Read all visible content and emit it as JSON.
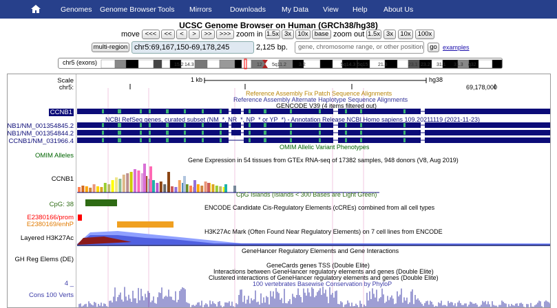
{
  "nav": {
    "items": [
      "Genomes",
      "Genome Browser",
      "Tools",
      "Mirrors",
      "Downloads",
      "My Data",
      "View",
      "Help",
      "About Us"
    ]
  },
  "title": "UCSC Genome Browser on Human (GRCh38/hg38)",
  "move": {
    "label": "move",
    "buttons": [
      "<<<",
      "<<",
      "<",
      ">",
      ">>",
      ">>>"
    ],
    "zoom_in_label": "zoom in",
    "zoom_in_buttons": [
      "1.5x",
      "3x",
      "10x",
      "base"
    ],
    "zoom_out_label": "zoom out",
    "zoom_out_buttons": [
      "1.5x",
      "3x",
      "10x",
      "100x"
    ]
  },
  "position": {
    "multi_region": "multi-region",
    "value": "chr5:69,167,150-69,178,245",
    "size": "2,125 bp.",
    "search_placeholder": "gene, chromosome range, or other position, see examples",
    "go": "go",
    "examples": "examples"
  },
  "ideogram": {
    "label": "chr5 (exons)",
    "bands": [
      "15.2",
      "14.3",
      "12",
      "5q11.2",
      "3.2",
      "5q14.3",
      "5q15",
      "21.3",
      "23.1",
      "23.2",
      "31.1",
      "31.3",
      "q32",
      "5q34"
    ]
  },
  "scale": {
    "label": "Scale",
    "chrom": "chr5:",
    "bar": "1 kb",
    "assembly": "hg38",
    "coord": "69,178,000"
  },
  "tracks": {
    "fix_patch": "Reference Assembly Fix Patch Sequence Alignments",
    "alt_haplo": "Reference Assembly Alternate Haplotype Sequence Alignments",
    "gencode": "GENCODE V39 (4 items filtered out)",
    "gencode_label": "CCNB1",
    "refseq": "NCBI RefSeq genes, curated subset (NM_*, NR_*, NP_* or YP_*) - Annotation Release NCBI Homo sapiens 109.20211119 (2021-11-23)",
    "refseq_labels": [
      "CNB1/NM_001354845.2",
      "CNB1/NM_001354844.2",
      "CCNB1/NM_031966.4"
    ],
    "omim": "OMIM Allelic Variant Phenotypes",
    "omim_label": "OMIM Alleles",
    "gtex": "Gene Expression in 54 tissues from GTEx RNA-seq of 17382 samples, 948 donors (V8, Aug 2019)",
    "gtex_label": "CCNB1",
    "cpg": "CpG Islands (Islands < 300 Bases are Light Green)",
    "cpg_label": "CpG: 38",
    "encode": "ENCODE Candidate Cis-Regulatory Elements (cCREs) combined from all cell types",
    "encode_labels": [
      "E2380166/prom",
      "E2380169/enhP"
    ],
    "h3k27ac": "H3K27Ac Mark (Often Found Near Regulatory Elements) on 7 cell lines from ENCODE",
    "h3k27ac_label": "Layered H3K27Ac",
    "genehancer": "GeneHancer Regulatory Elements and Gene Interactions",
    "genehancer_label": "GH Reg Elems (DE)",
    "gh_tss": "GeneCards genes TSS (Double Elite)",
    "gh_interactions": "Interactions between GeneHancer regulatory elements and genes (Double Elite)",
    "gh_clustered": "Clustered interactions of GeneHancer regulatory elements and genes (Double Elite)",
    "phylop": "100 vertebrates Basewise Conservation by PhyloP",
    "cons_label": "Cons 100 Verts",
    "cons_scale": "4 _"
  },
  "colors": {
    "nav": "#27408b",
    "gene": "#0c0c78",
    "omim": "#006400",
    "cpg": "#2e6b14",
    "encode_prom": "#ff0000",
    "encode_enh": "#ffa500",
    "phylop": "#3c3ca8"
  }
}
